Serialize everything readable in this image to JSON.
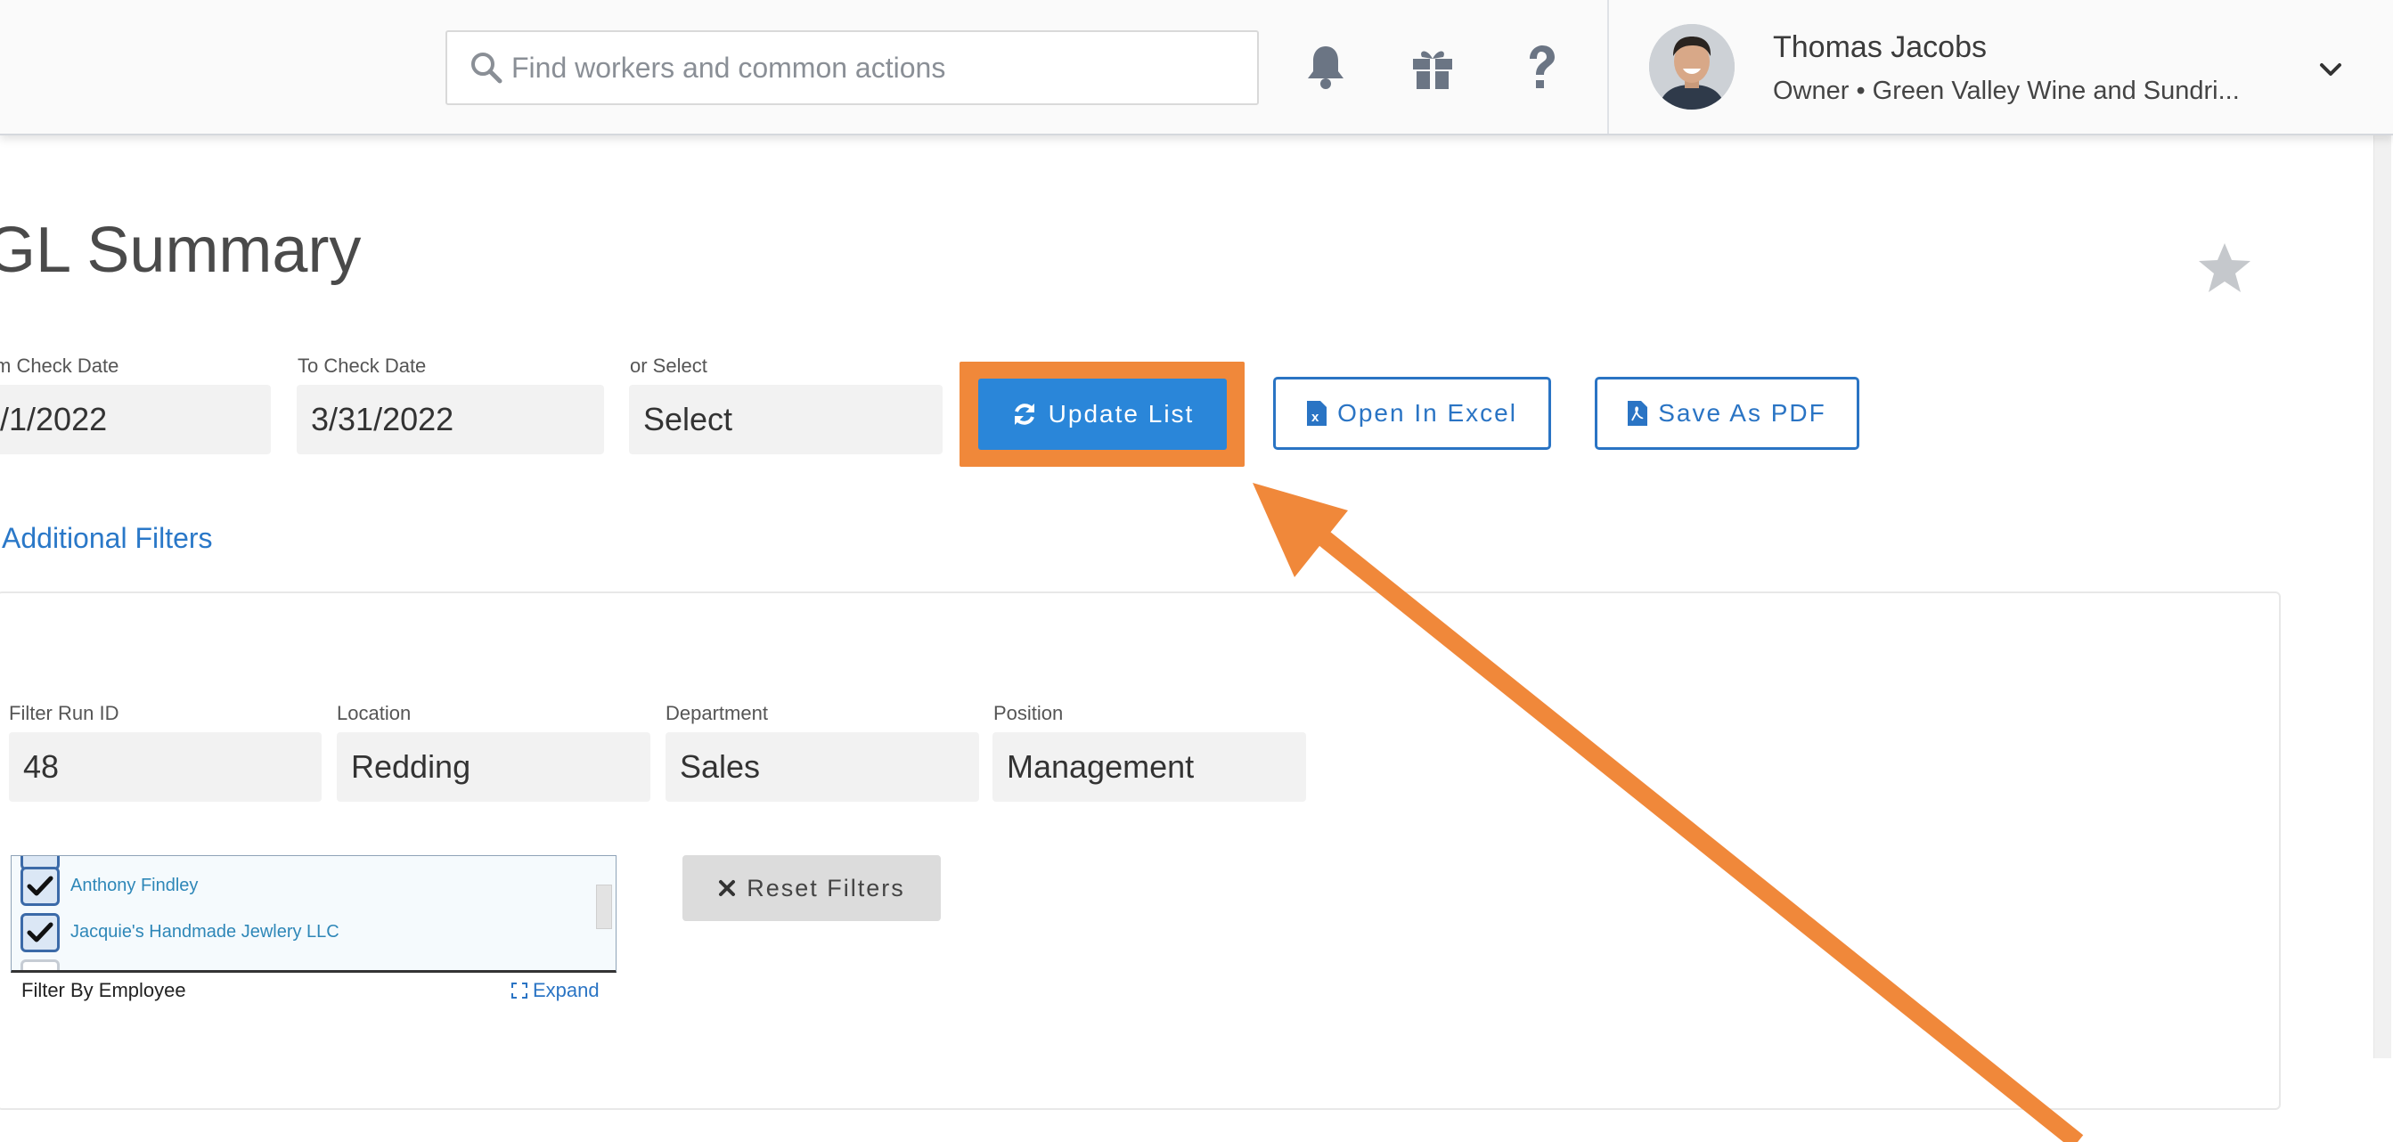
{
  "header": {
    "search_placeholder": "Find workers and common actions",
    "user_name": "Thomas Jacobs",
    "user_role": "Owner • Green Valley Wine and Sundri..."
  },
  "page": {
    "title": "GL Summary"
  },
  "date_filters": {
    "from_label": "m Check Date",
    "from_value": "/1/2022",
    "to_label": "To Check Date",
    "to_value": "3/31/2022",
    "select_label": "or Select",
    "select_value": "Select"
  },
  "buttons": {
    "update_list": "Update List",
    "open_excel": "Open In Excel",
    "save_pdf": "Save As PDF",
    "reset_filters": "Reset Filters"
  },
  "additional_filters": {
    "toggle_label": "Additional Filters",
    "fields": [
      {
        "label": "Filter Run ID",
        "value": "48"
      },
      {
        "label": "Location",
        "value": "Redding"
      },
      {
        "label": "Department",
        "value": "Sales"
      },
      {
        "label": "Position",
        "value": "Management"
      }
    ]
  },
  "employee_filter": {
    "items": [
      {
        "name": "Anthony Findley",
        "checked": true
      },
      {
        "name": "Jacquie's Handmade Jewlery LLC",
        "checked": true
      }
    ],
    "label": "Filter By Employee",
    "expand_label": "Expand"
  },
  "colors": {
    "accent_blue": "#2a86d9",
    "highlight_orange": "#f0883a"
  },
  "icons": [
    "search-icon",
    "bell-icon",
    "gift-icon",
    "help-icon",
    "chevron-down-icon",
    "star-icon",
    "refresh-icon",
    "excel-file-icon",
    "pdf-file-icon",
    "close-icon",
    "expand-icon",
    "checkmark-icon"
  ]
}
